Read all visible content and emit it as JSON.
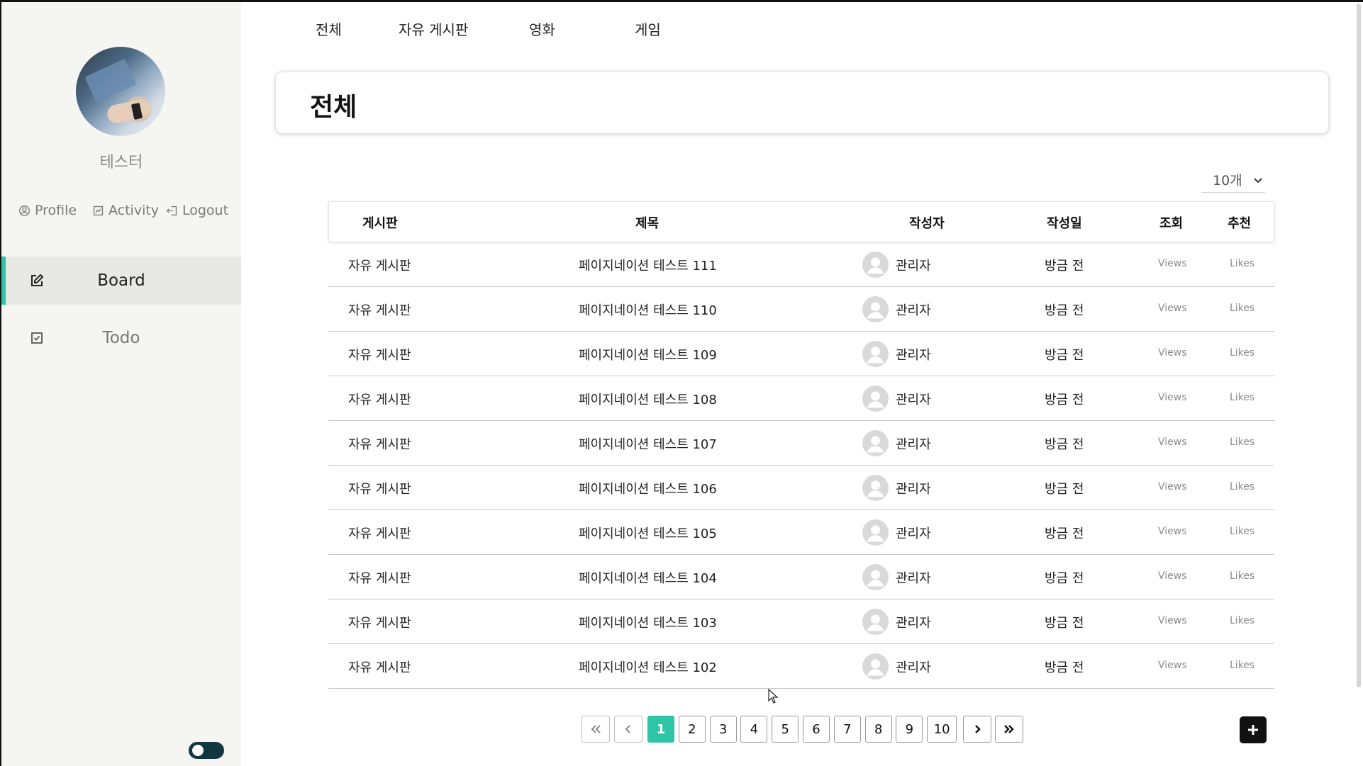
{
  "sidebar": {
    "username": "테스터",
    "user_links": [
      {
        "label": "Profile",
        "icon": "user-circle-icon"
      },
      {
        "label": "Activity",
        "icon": "activity-icon"
      },
      {
        "label": "Logout",
        "icon": "logout-icon"
      }
    ],
    "nav": [
      {
        "label": "Board",
        "icon": "edit-icon",
        "active": true
      },
      {
        "label": "Todo",
        "icon": "checkbox-icon",
        "active": false
      }
    ],
    "theme_toggle": {
      "state": "on"
    }
  },
  "top_tabs": [
    "전체",
    "자유 게시판",
    "영화",
    "게임"
  ],
  "page": {
    "title": "전체",
    "page_size": "10개"
  },
  "table": {
    "headers": [
      "게시판",
      "제목",
      "작성자",
      "작성일",
      "조회",
      "추천"
    ],
    "rows": [
      {
        "board": "자유 게시판",
        "title": "페이지네이션 테스트 111",
        "author": "관리자",
        "date": "방금 전",
        "views": "Views",
        "likes": "Likes"
      },
      {
        "board": "자유 게시판",
        "title": "페이지네이션 테스트 110",
        "author": "관리자",
        "date": "방금 전",
        "views": "Views",
        "likes": "Likes"
      },
      {
        "board": "자유 게시판",
        "title": "페이지네이션 테스트 109",
        "author": "관리자",
        "date": "방금 전",
        "views": "Views",
        "likes": "Likes"
      },
      {
        "board": "자유 게시판",
        "title": "페이지네이션 테스트 108",
        "author": "관리자",
        "date": "방금 전",
        "views": "Views",
        "likes": "Likes"
      },
      {
        "board": "자유 게시판",
        "title": "페이지네이션 테스트 107",
        "author": "관리자",
        "date": "방금 전",
        "views": "Views",
        "likes": "Likes"
      },
      {
        "board": "자유 게시판",
        "title": "페이지네이션 테스트 106",
        "author": "관리자",
        "date": "방금 전",
        "views": "Views",
        "likes": "Likes"
      },
      {
        "board": "자유 게시판",
        "title": "페이지네이션 테스트 105",
        "author": "관리자",
        "date": "방금 전",
        "views": "Views",
        "likes": "Likes"
      },
      {
        "board": "자유 게시판",
        "title": "페이지네이션 테스트 104",
        "author": "관리자",
        "date": "방금 전",
        "views": "Views",
        "likes": "Likes"
      },
      {
        "board": "자유 게시판",
        "title": "페이지네이션 테스트 103",
        "author": "관리자",
        "date": "방금 전",
        "views": "Views",
        "likes": "Likes"
      },
      {
        "board": "자유 게시판",
        "title": "페이지네이션 테스트 102",
        "author": "관리자",
        "date": "방금 전",
        "views": "Views",
        "likes": "Likes"
      }
    ]
  },
  "pagination": {
    "pages": [
      "1",
      "2",
      "3",
      "4",
      "5",
      "6",
      "7",
      "8",
      "9",
      "10"
    ],
    "current": "1"
  },
  "colors": {
    "accent": "#2ec4a6",
    "sidebar_bg": "#f5f5f1",
    "toggle": "#12363f"
  }
}
